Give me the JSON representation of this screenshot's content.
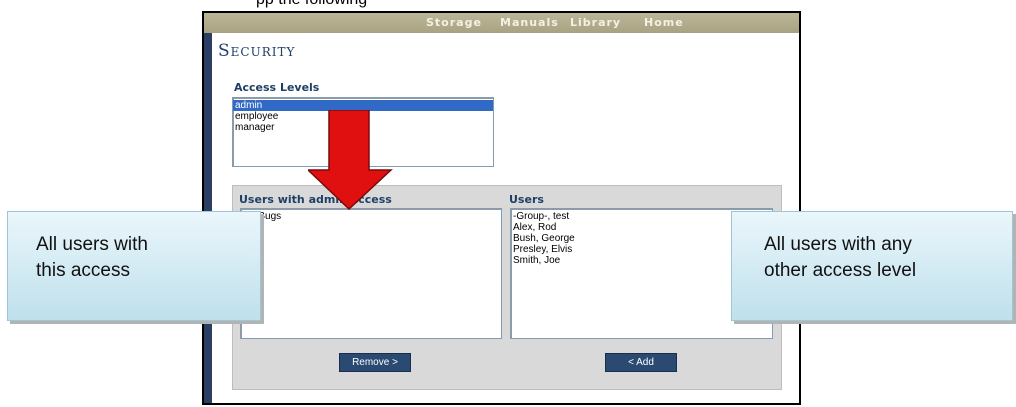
{
  "caption": "pp the following",
  "nav": {
    "items": [
      "Storage",
      "Manuals",
      "Library",
      "Home"
    ]
  },
  "page": {
    "title": "Security"
  },
  "access_levels": {
    "label": "Access Levels",
    "options": [
      "admin",
      "employee",
      "manager"
    ],
    "selected": "admin"
  },
  "assigned_users": {
    "label": "Users with admin access",
    "items": [
      "ny, Bugs"
    ]
  },
  "all_users": {
    "label": "Users",
    "items": [
      "-Group-, test",
      "Alex, Rod",
      "Bush, George",
      "Presley, Elvis",
      "Smith, Joe"
    ]
  },
  "buttons": {
    "remove": "Remove >",
    "add": "< Add"
  },
  "callouts": {
    "left": [
      "All users with",
      "this access"
    ],
    "right": [
      "All users with any",
      "other access level"
    ]
  },
  "colors": {
    "nav_bg": "#b0a98b",
    "title": "#1e3f66",
    "accent_stripe": "#2b3f63",
    "selection": "#3169c6",
    "arrow": "#e01010"
  }
}
